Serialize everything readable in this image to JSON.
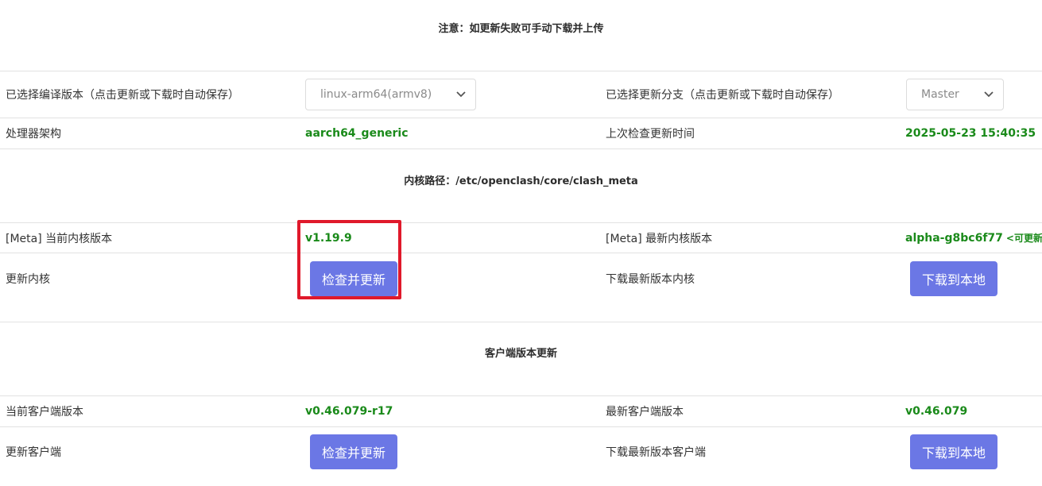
{
  "notice": "注意：如更新失败可手动下载并上传",
  "compile_version": {
    "label": "已选择编译版本（点击更新或下载时自动保存）",
    "selected": "linux-arm64(armv8)"
  },
  "update_branch": {
    "label": "已选择更新分支（点击更新或下载时自动保存）",
    "selected": "Master"
  },
  "arch": {
    "label": "处理器架构",
    "value": "aarch64_generic"
  },
  "last_check": {
    "label": "上次检查更新时间",
    "value": "2025-05-23 15:40:35"
  },
  "core_path": "内核路径：/etc/openclash/core/clash_meta",
  "core": {
    "current_label": "[Meta] 当前内核版本",
    "current_value": "v1.19.9",
    "latest_label": "[Meta] 最新内核版本",
    "latest_value": "alpha-g8bc6f77",
    "latest_tag": "<可更新>",
    "update_label": "更新内核",
    "update_button": "检查并更新",
    "download_label": "下载最新版本内核",
    "download_button": "下载到本地"
  },
  "client_section_title": "客户端版本更新",
  "client": {
    "current_label": "当前客户端版本",
    "current_value": "v0.46.079-r17",
    "latest_label": "最新客户端版本",
    "latest_value": "v0.46.079",
    "update_label": "更新客户端",
    "update_button": "检查并更新",
    "download_label": "下载最新版本客户端",
    "download_button": "下载到本地"
  },
  "colors": {
    "accent_button": "#6b77e5",
    "value_green": "#1a8a1a",
    "highlight_red": "#e0192b"
  }
}
